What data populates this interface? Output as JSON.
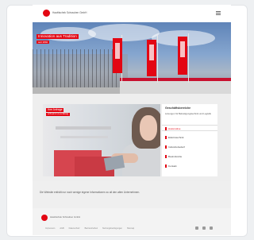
{
  "header": {
    "brand": "Hawlitschek Schrauben GmbH",
    "menu_icon": "hamburger-menu-icon"
  },
  "hero": {
    "title": "Innovation aus Tradition",
    "subtitle": "seit 1892"
  },
  "feature": {
    "photo_title": "Ihre Anfrage",
    "photo_subtitle": "schnell & zuverlässig"
  },
  "sidebar": {
    "title": "Geschäftsbereiche",
    "text": "Lösungen für Befestigungstechnik und Logistik",
    "items": [
      {
        "label": "Automotive",
        "active": true
      },
      {
        "label": "Elektrotechnik",
        "active": false
      },
      {
        "label": "Industriebedarf",
        "active": false
      },
      {
        "label": "Bauindustrie",
        "active": false
      },
      {
        "label": "Kontakt",
        "active": false
      }
    ]
  },
  "notice": {
    "text": "Die Website enthält nur noch wenige eigene Informationen zu all den alten Unternehmen."
  },
  "footer": {
    "brand": "Hawlitschek Schrauben GmbH",
    "links": [
      "Impressum",
      "AGB",
      "Datenschutz",
      "Barrierefreiheit",
      "Nutzungsbedingungen",
      "Sitemap"
    ]
  },
  "colors": {
    "accent": "#e30613",
    "page_bg": "#eef0f2"
  }
}
